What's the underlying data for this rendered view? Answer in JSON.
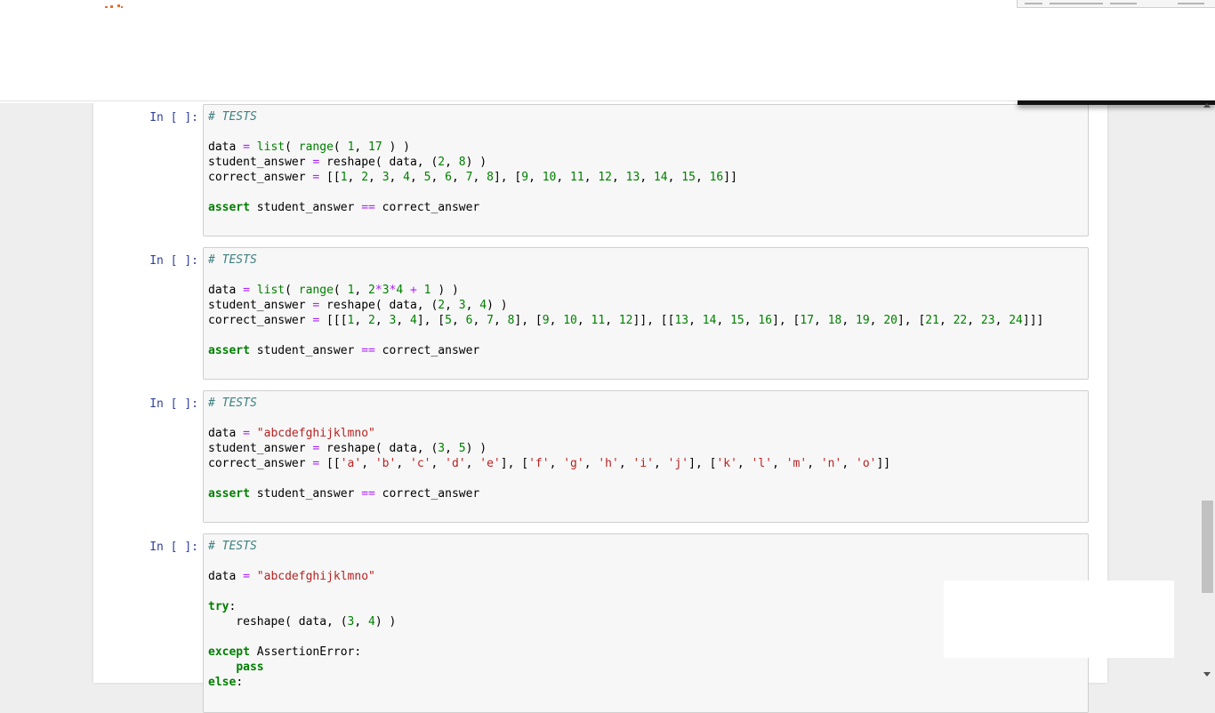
{
  "cells": [
    {
      "prompt": "In [ ]:",
      "lines": [
        [
          [
            "cm",
            "# TESTS"
          ]
        ],
        [],
        [
          [
            "",
            "data "
          ],
          [
            "op",
            "="
          ],
          [
            "",
            " "
          ],
          [
            "bi",
            "list"
          ],
          [
            "",
            "( "
          ],
          [
            "bi",
            "range"
          ],
          [
            "",
            "( "
          ],
          [
            "nm",
            "1"
          ],
          [
            "",
            ", "
          ],
          [
            "nm",
            "17"
          ],
          [
            "",
            " ) )"
          ]
        ],
        [
          [
            "",
            "student_answer "
          ],
          [
            "op",
            "="
          ],
          [
            "",
            " reshape( data, ("
          ],
          [
            "nm",
            "2"
          ],
          [
            "",
            ", "
          ],
          [
            "nm",
            "8"
          ],
          [
            "",
            ") )"
          ]
        ],
        [
          [
            "",
            "correct_answer "
          ],
          [
            "op",
            "="
          ],
          [
            "",
            " [["
          ],
          [
            "nm",
            "1"
          ],
          [
            "",
            ", "
          ],
          [
            "nm",
            "2"
          ],
          [
            "",
            ", "
          ],
          [
            "nm",
            "3"
          ],
          [
            "",
            ", "
          ],
          [
            "nm",
            "4"
          ],
          [
            "",
            ", "
          ],
          [
            "nm",
            "5"
          ],
          [
            "",
            ", "
          ],
          [
            "nm",
            "6"
          ],
          [
            "",
            ", "
          ],
          [
            "nm",
            "7"
          ],
          [
            "",
            ", "
          ],
          [
            "nm",
            "8"
          ],
          [
            "",
            "], ["
          ],
          [
            "nm",
            "9"
          ],
          [
            "",
            ", "
          ],
          [
            "nm",
            "10"
          ],
          [
            "",
            ", "
          ],
          [
            "nm",
            "11"
          ],
          [
            "",
            ", "
          ],
          [
            "nm",
            "12"
          ],
          [
            "",
            ", "
          ],
          [
            "nm",
            "13"
          ],
          [
            "",
            ", "
          ],
          [
            "nm",
            "14"
          ],
          [
            "",
            ", "
          ],
          [
            "nm",
            "15"
          ],
          [
            "",
            ", "
          ],
          [
            "nm",
            "16"
          ],
          [
            "",
            "]]"
          ]
        ],
        [],
        [
          [
            "kw",
            "assert"
          ],
          [
            "",
            " student_answer "
          ],
          [
            "op",
            "=="
          ],
          [
            "",
            " correct_answer"
          ]
        ],
        []
      ]
    },
    {
      "prompt": "In [ ]:",
      "lines": [
        [
          [
            "cm",
            "# TESTS"
          ]
        ],
        [],
        [
          [
            "",
            "data "
          ],
          [
            "op",
            "="
          ],
          [
            "",
            " "
          ],
          [
            "bi",
            "list"
          ],
          [
            "",
            "( "
          ],
          [
            "bi",
            "range"
          ],
          [
            "",
            "( "
          ],
          [
            "nm",
            "1"
          ],
          [
            "",
            ", "
          ],
          [
            "nm",
            "2"
          ],
          [
            "op",
            "*"
          ],
          [
            "nm",
            "3"
          ],
          [
            "op",
            "*"
          ],
          [
            "nm",
            "4"
          ],
          [
            "",
            " "
          ],
          [
            "op",
            "+"
          ],
          [
            "",
            " "
          ],
          [
            "nm",
            "1"
          ],
          [
            "",
            " ) )"
          ]
        ],
        [
          [
            "",
            "student_answer "
          ],
          [
            "op",
            "="
          ],
          [
            "",
            " reshape( data, ("
          ],
          [
            "nm",
            "2"
          ],
          [
            "",
            ", "
          ],
          [
            "nm",
            "3"
          ],
          [
            "",
            ", "
          ],
          [
            "nm",
            "4"
          ],
          [
            "",
            ") )"
          ]
        ],
        [
          [
            "",
            "correct_answer "
          ],
          [
            "op",
            "="
          ],
          [
            "",
            " [[["
          ],
          [
            "nm",
            "1"
          ],
          [
            "",
            ", "
          ],
          [
            "nm",
            "2"
          ],
          [
            "",
            ", "
          ],
          [
            "nm",
            "3"
          ],
          [
            "",
            ", "
          ],
          [
            "nm",
            "4"
          ],
          [
            "",
            "], ["
          ],
          [
            "nm",
            "5"
          ],
          [
            "",
            ", "
          ],
          [
            "nm",
            "6"
          ],
          [
            "",
            ", "
          ],
          [
            "nm",
            "7"
          ],
          [
            "",
            ", "
          ],
          [
            "nm",
            "8"
          ],
          [
            "",
            "], ["
          ],
          [
            "nm",
            "9"
          ],
          [
            "",
            ", "
          ],
          [
            "nm",
            "10"
          ],
          [
            "",
            ", "
          ],
          [
            "nm",
            "11"
          ],
          [
            "",
            ", "
          ],
          [
            "nm",
            "12"
          ],
          [
            "",
            "]], [["
          ],
          [
            "nm",
            "13"
          ],
          [
            "",
            ", "
          ],
          [
            "nm",
            "14"
          ],
          [
            "",
            ", "
          ],
          [
            "nm",
            "15"
          ],
          [
            "",
            ", "
          ],
          [
            "nm",
            "16"
          ],
          [
            "",
            "], ["
          ],
          [
            "nm",
            "17"
          ],
          [
            "",
            ", "
          ],
          [
            "nm",
            "18"
          ],
          [
            "",
            ", "
          ],
          [
            "nm",
            "19"
          ],
          [
            "",
            ", "
          ],
          [
            "nm",
            "20"
          ],
          [
            "",
            "], ["
          ],
          [
            "nm",
            "21"
          ],
          [
            "",
            ", "
          ],
          [
            "nm",
            "22"
          ],
          [
            "",
            ", "
          ],
          [
            "nm",
            "23"
          ],
          [
            "",
            ", "
          ],
          [
            "nm",
            "24"
          ],
          [
            "",
            "]]]"
          ]
        ],
        [],
        [
          [
            "kw",
            "assert"
          ],
          [
            "",
            " student_answer "
          ],
          [
            "op",
            "=="
          ],
          [
            "",
            " correct_answer"
          ]
        ],
        []
      ]
    },
    {
      "prompt": "In [ ]:",
      "lines": [
        [
          [
            "cm",
            "# TESTS"
          ]
        ],
        [],
        [
          [
            "",
            "data "
          ],
          [
            "op",
            "="
          ],
          [
            "",
            " "
          ],
          [
            "st",
            "\"abcdefghijklmno\""
          ]
        ],
        [
          [
            "",
            "student_answer "
          ],
          [
            "op",
            "="
          ],
          [
            "",
            " reshape( data, ("
          ],
          [
            "nm",
            "3"
          ],
          [
            "",
            ", "
          ],
          [
            "nm",
            "5"
          ],
          [
            "",
            ") )"
          ]
        ],
        [
          [
            "",
            "correct_answer "
          ],
          [
            "op",
            "="
          ],
          [
            "",
            " [["
          ],
          [
            "st",
            "'a'"
          ],
          [
            "",
            ", "
          ],
          [
            "st",
            "'b'"
          ],
          [
            "",
            ", "
          ],
          [
            "st",
            "'c'"
          ],
          [
            "",
            ", "
          ],
          [
            "st",
            "'d'"
          ],
          [
            "",
            ", "
          ],
          [
            "st",
            "'e'"
          ],
          [
            "",
            "], ["
          ],
          [
            "st",
            "'f'"
          ],
          [
            "",
            ", "
          ],
          [
            "st",
            "'g'"
          ],
          [
            "",
            ", "
          ],
          [
            "st",
            "'h'"
          ],
          [
            "",
            ", "
          ],
          [
            "st",
            "'i'"
          ],
          [
            "",
            ", "
          ],
          [
            "st",
            "'j'"
          ],
          [
            "",
            "], ["
          ],
          [
            "st",
            "'k'"
          ],
          [
            "",
            ", "
          ],
          [
            "st",
            "'l'"
          ],
          [
            "",
            ", "
          ],
          [
            "st",
            "'m'"
          ],
          [
            "",
            ", "
          ],
          [
            "st",
            "'n'"
          ],
          [
            "",
            ", "
          ],
          [
            "st",
            "'o'"
          ],
          [
            "",
            "]]"
          ]
        ],
        [],
        [
          [
            "kw",
            "assert"
          ],
          [
            "",
            " student_answer "
          ],
          [
            "op",
            "=="
          ],
          [
            "",
            " correct_answer"
          ]
        ],
        []
      ]
    },
    {
      "prompt": "In [ ]:",
      "lines": [
        [
          [
            "cm",
            "# TESTS"
          ]
        ],
        [],
        [
          [
            "",
            "data "
          ],
          [
            "op",
            "="
          ],
          [
            "",
            " "
          ],
          [
            "st",
            "\"abcdefghijklmno\""
          ]
        ],
        [],
        [
          [
            "kw",
            "try"
          ],
          [
            "",
            ":"
          ]
        ],
        [
          [
            "",
            "    reshape( data, ("
          ],
          [
            "nm",
            "3"
          ],
          [
            "",
            ", "
          ],
          [
            "nm",
            "4"
          ],
          [
            "",
            ") )"
          ]
        ],
        [],
        [
          [
            "kw",
            "except"
          ],
          [
            "",
            " AssertionError:"
          ]
        ],
        [
          [
            "",
            "    "
          ],
          [
            "kw",
            "pass"
          ]
        ],
        [
          [
            "kw",
            "else"
          ],
          [
            "",
            ":"
          ]
        ]
      ]
    }
  ]
}
